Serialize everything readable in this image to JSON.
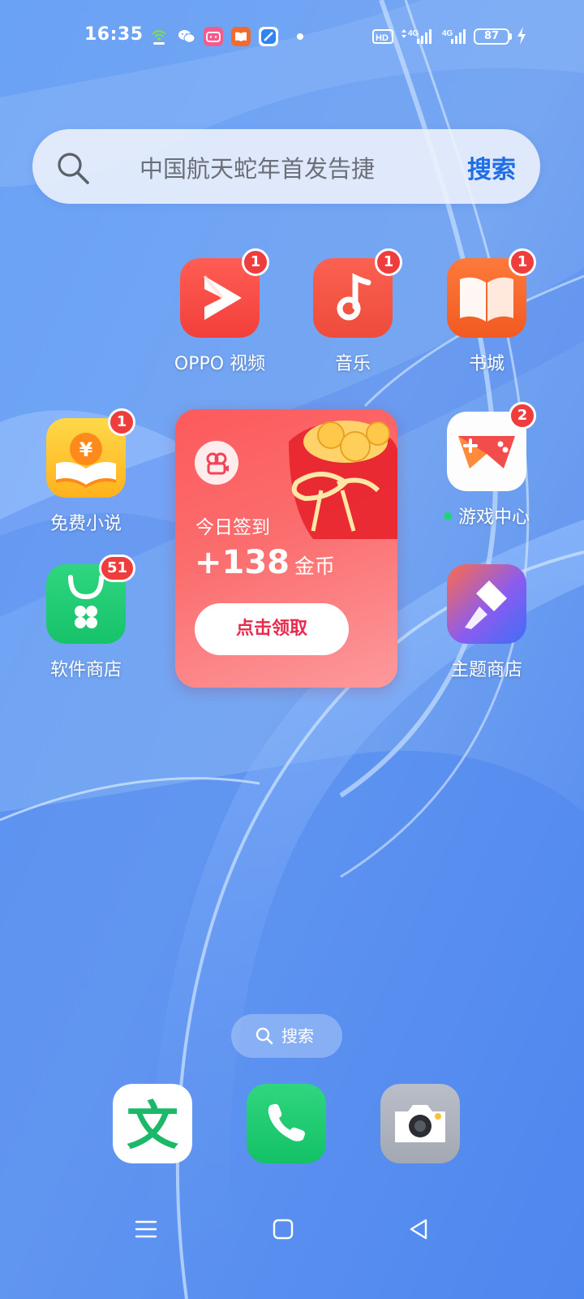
{
  "status_bar": {
    "time": "16:35",
    "notification_icons": [
      "wifi-share-icon",
      "wechat-icon",
      "bilibili-icon",
      "book-icon",
      "browser-icon"
    ],
    "indicators": [
      "hd-icon",
      "4g-signal-icon",
      "4g-signal-icon-2"
    ],
    "hd_text": "HD",
    "network_label": "4G",
    "battery": "87",
    "charging": true
  },
  "search_widget": {
    "query": "中国航天蛇年首发告捷",
    "button": "搜索"
  },
  "apps": {
    "oppo_video": {
      "label": "OPPO 视频",
      "badge": "1"
    },
    "music": {
      "label": "音乐",
      "badge": "1"
    },
    "bookstore": {
      "label": "书城",
      "badge": "1"
    },
    "free_novel": {
      "label": "免费小说",
      "badge": "1"
    },
    "game_center": {
      "label": "游戏中心",
      "badge": "2"
    },
    "app_store": {
      "label": "软件商店",
      "badge": "51"
    },
    "theme_store": {
      "label": "主题商店"
    }
  },
  "checkin_widget": {
    "title": "今日签到",
    "amount": "+138",
    "unit": "金币",
    "button": "点击领取"
  },
  "search_pill": {
    "label": "搜索"
  },
  "dock": [
    "translate-app",
    "phone-app",
    "camera-app"
  ],
  "dock_text": {
    "translate_glyph": "文"
  },
  "nav_bar": [
    "menu-icon",
    "home-icon",
    "back-icon"
  ],
  "colors": {
    "accent_blue": "#1f6ee6",
    "badge_red": "#ef3c3c",
    "widget_red": "#fd5a5c",
    "claim_text": "#e8294c"
  }
}
